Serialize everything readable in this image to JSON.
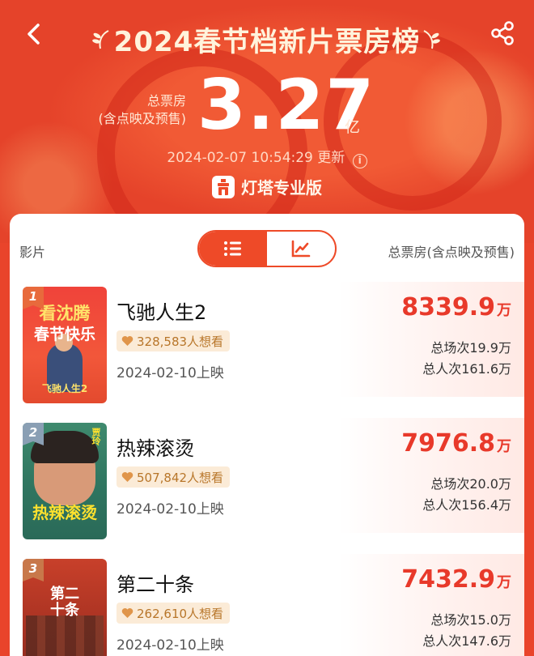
{
  "header": {
    "title": "2024春节档新片票房榜",
    "total_label_line1": "总票房",
    "total_label_line2": "(含点映及预售)",
    "total_value": "3.27",
    "total_unit": "亿",
    "update_time": "2024-02-07 10:54:29",
    "update_suffix": "更新",
    "brand": "灯塔专业版"
  },
  "icons": {
    "back": "back-arrow-icon",
    "share": "share-icon",
    "info": "info-icon",
    "list_view": "list-icon",
    "trend_view": "trend-chart-icon",
    "want": "heart-icon"
  },
  "table": {
    "col_movie": "影片",
    "col_gross": "总票房(含点映及预售)",
    "active_view": "list"
  },
  "movies": [
    {
      "rank": "1",
      "title": "飞驰人生2",
      "want": "328,583人想看",
      "release": "2024-02-10上映",
      "gross": "8339.9",
      "gross_unit": "万",
      "shows": "总场次19.9万",
      "admissions": "总人次161.6万",
      "poster_line1": "看沈腾",
      "poster_line2": "春节快乐",
      "poster_caption": "飞驰人生2"
    },
    {
      "rank": "2",
      "title": "热辣滚烫",
      "want": "507,842人想看",
      "release": "2024-02-10上映",
      "gross": "7976.8",
      "gross_unit": "万",
      "shows": "总场次20.0万",
      "admissions": "总人次156.4万",
      "poster_line1": "热辣滚烫",
      "poster_caption": "贾玲"
    },
    {
      "rank": "3",
      "title": "第二十条",
      "want": "262,610人想看",
      "release": "2024-02-10上映",
      "gross": "7432.9",
      "gross_unit": "万",
      "shows": "总场次15.0万",
      "admissions": "总人次147.6万",
      "poster_line1": "第二",
      "poster_line2": "十条"
    }
  ],
  "colors": {
    "brand_red": "#e9442b",
    "gross_red": "#e8392a",
    "want_gold": "#b8762a"
  }
}
